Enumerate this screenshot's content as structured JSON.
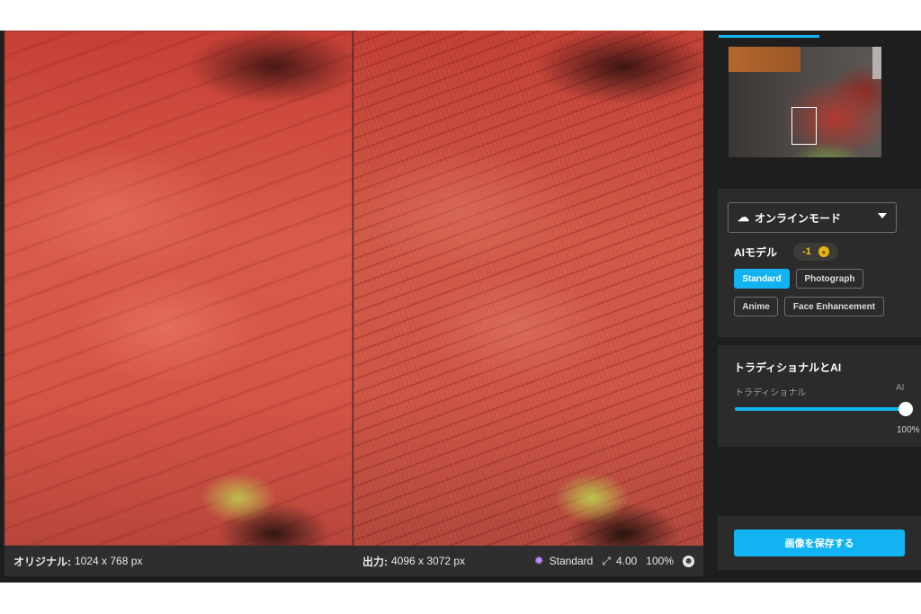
{
  "status": {
    "original_label": "オリジナル:",
    "original_size": "1024 x 768 px",
    "output_label": "出力:",
    "output_size": "4096 x 3072 px",
    "model": "Standard",
    "scale": "4.00",
    "zoom": "100%",
    "icons": [
      "sparkle-icon",
      "expand-icon",
      "smile-icon"
    ]
  },
  "sidebar": {
    "mode": "オンラインモード",
    "ai_model_label": "AIモデル",
    "credit": "-1",
    "models": [
      "Standard",
      "Photograph",
      "Anime",
      "Face Enhancement"
    ],
    "selected_model": "Standard",
    "blend_title": "トラディショナルとAI",
    "slider_left_label": "トラディショナル",
    "slider_right_label": "AI",
    "slider_value": 1.0,
    "slider_percent": "100%",
    "save_button": "画像を保存する"
  },
  "colors": {
    "accent": "#13b3f2",
    "panel": "#2b2b2b",
    "background": "#1e1e1e",
    "credit_text": "#f0c020"
  }
}
